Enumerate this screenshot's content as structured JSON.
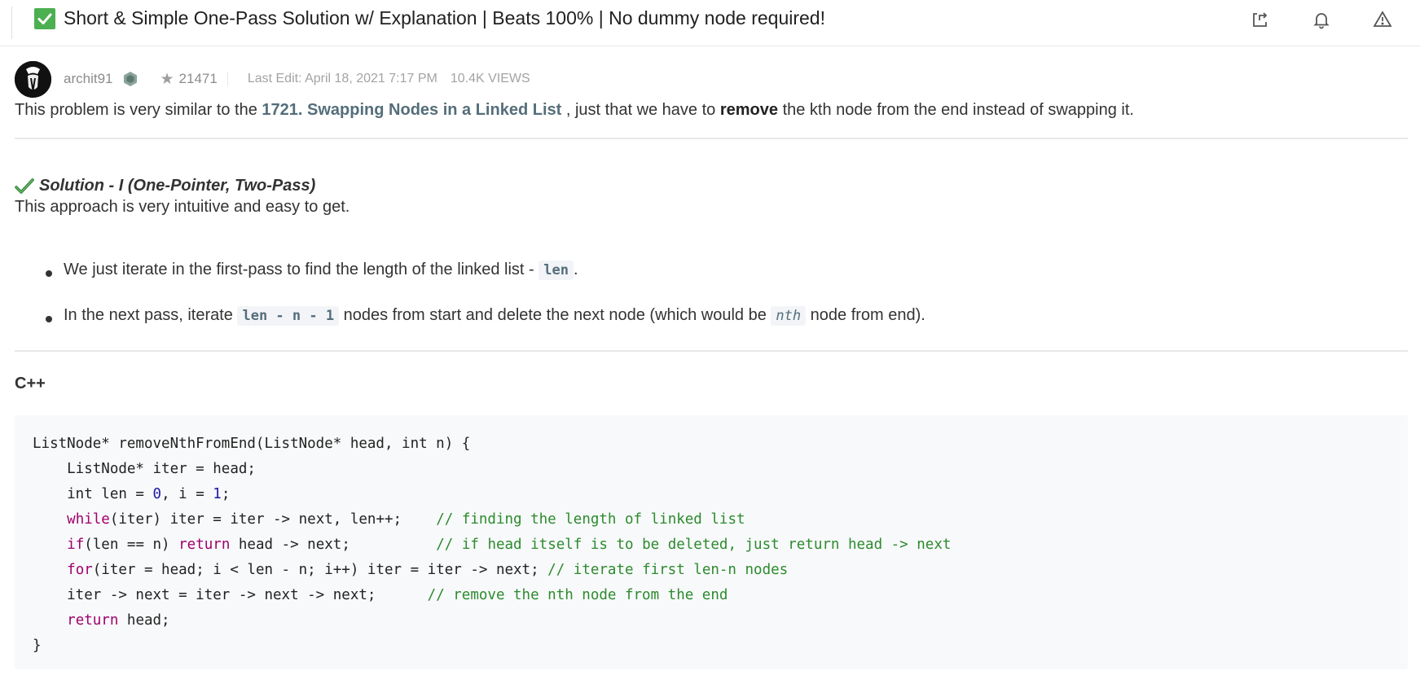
{
  "header": {
    "title": "Short & Simple One-Pass Solution w/ Explanation | Beats 100% | No dummy node required!",
    "icons": [
      "share-icon",
      "bell-icon",
      "report-icon"
    ]
  },
  "meta": {
    "username": "archit91",
    "reputation": "21471",
    "last_edit": "Last Edit: April 18, 2021 7:17 PM",
    "views": "10.4K VIEWS"
  },
  "intro": {
    "before": "This problem is very similar to the ",
    "link": "1721. Swapping Nodes in a Linked List",
    "middle": " , just that we have to ",
    "bold": "remove",
    "after": " the kth node from the end instead of swapping it."
  },
  "solution": {
    "title": "Solution - I (One-Pointer, Two-Pass)",
    "description": "This approach is very intuitive and easy to get.",
    "bullet1_before": "We just iterate in the first-pass to find the length of the linked list - ",
    "bullet1_code": "len",
    "bullet1_after": ".",
    "bullet2_before": "In the next pass, iterate ",
    "bullet2_code": "len - n - 1",
    "bullet2_middle": " nodes from start and delete the next node (which would be ",
    "bullet2_code2": "nth",
    "bullet2_after": " node from end)."
  },
  "code_section": {
    "language": "C++",
    "lines": [
      "ListNode* removeNthFromEnd(ListNode* head, int n) {",
      "    ListNode* iter = head;",
      "    int len = 0, i = 1;",
      "    while(iter) iter = iter -> next, len++;    // finding the length of linked list",
      "    if(len == n) return head -> next;          // if head itself is to be deleted, just return head -> next",
      "    for(iter = head; i < len - n; i++) iter = iter -> next; // iterate first len-n nodes",
      "    iter -> next = iter -> next -> next;      // remove the nth node from the end",
      "    return head;",
      "}"
    ]
  },
  "colors": {
    "accent_link": "#546e7a",
    "check_green": "#4caf50",
    "keyword": "#a0006b",
    "comment": "#2d8a2d",
    "number": "#1a1aa6"
  }
}
